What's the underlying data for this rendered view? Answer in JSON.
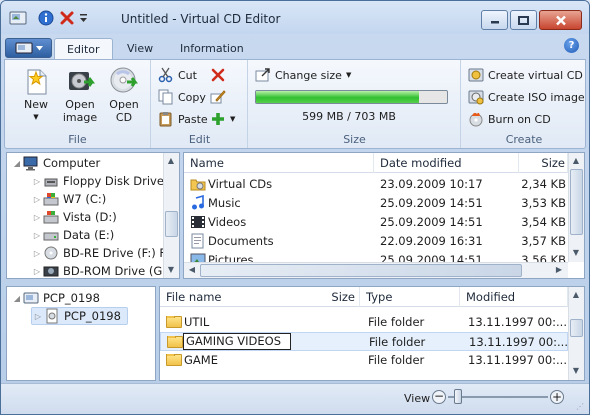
{
  "window": {
    "title": "Untitled - Virtual CD Editor"
  },
  "tabs": [
    {
      "label": "Editor"
    },
    {
      "label": "View"
    },
    {
      "label": "Information"
    }
  ],
  "ribbon": {
    "file_group": {
      "label": "File",
      "new": "New",
      "open_image": "Open\nimage",
      "open_cd": "Open\nCD"
    },
    "edit_group": {
      "label": "Edit",
      "cut": "Cut",
      "copy": "Copy",
      "paste": "Paste"
    },
    "size_group": {
      "label": "Size",
      "change_size": "Change size",
      "usage_text": "599 MB / 703 MB",
      "usage_fraction": 0.852
    },
    "create_group": {
      "label": "Create",
      "create_virtual_cd": "Create virtual CD",
      "create_iso_image": "Create ISO image",
      "burn_on_cd": "Burn on CD"
    }
  },
  "tree": [
    {
      "label": "Computer",
      "icon": "computer-icon",
      "level": 0
    },
    {
      "label": "Floppy Disk Drive",
      "icon": "floppy-icon",
      "level": 1
    },
    {
      "label": "W7 (C:)",
      "icon": "drive-windows-icon",
      "level": 1
    },
    {
      "label": "Vista (D:)",
      "icon": "drive-windows-icon",
      "level": 1
    },
    {
      "label": "Data (E:)",
      "icon": "drive-icon",
      "level": 1
    },
    {
      "label": "BD-RE Drive (F:) F",
      "icon": "optical-drive-icon",
      "level": 1
    },
    {
      "label": "BD-ROM Drive (G:",
      "icon": "optical-drive-icon",
      "level": 1
    }
  ],
  "file_list": {
    "columns": [
      "Name",
      "Date modified",
      "Size"
    ],
    "rows": [
      {
        "name": "Virtual CDs",
        "date": "23.09.2009 10:17",
        "size": "2,34 KB",
        "icon": "virtual-cd-folder-icon"
      },
      {
        "name": "Music",
        "date": "25.09.2009 14:51",
        "size": "3,53 KB",
        "icon": "music-icon"
      },
      {
        "name": "Videos",
        "date": "25.09.2009 14:51",
        "size": "3,54 KB",
        "icon": "video-icon"
      },
      {
        "name": "Documents",
        "date": "22.09.2009 16:31",
        "size": "3,57 KB",
        "icon": "documents-icon"
      },
      {
        "name": "Pictures",
        "date": "25.09.2009 14:51",
        "size": "3,56 KB",
        "icon": "pictures-icon"
      }
    ]
  },
  "cd_tree": [
    {
      "label": "PCP_0198",
      "icon": "cd-image-icon",
      "level": 0
    },
    {
      "label": "PCP_0198",
      "icon": "disc-icon",
      "level": 1
    }
  ],
  "cd_list": {
    "columns": [
      "File name",
      "Size",
      "Type",
      "Modified"
    ],
    "rows": [
      {
        "name": "UTIL",
        "size": "",
        "type": "File folder",
        "modified": "13.11.1997 00:..."
      },
      {
        "name": "GAMING VIDEOS",
        "size": "",
        "type": "File folder",
        "modified": "13.11.1997 00:...",
        "editing": true
      },
      {
        "name": "GAME",
        "size": "",
        "type": "File folder",
        "modified": "13.11.1997 00:..."
      }
    ]
  },
  "statusbar": {
    "view_label": "View",
    "zoom_fraction": 0.1
  }
}
